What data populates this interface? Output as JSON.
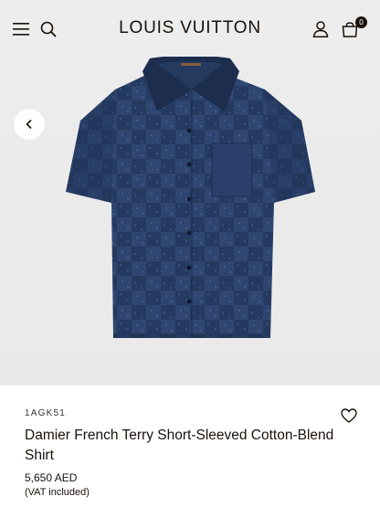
{
  "header": {
    "brand": "LOUIS VUITTON",
    "bag_count": "0",
    "icons": [
      "menu-icon",
      "search-icon",
      "account-icon",
      "shopping-bag-icon"
    ]
  },
  "gallery": {
    "back_icon": "chevron-left-icon",
    "image": "navy-damier-short-sleeve-shirt"
  },
  "product": {
    "sku": "1AGK51",
    "title": "Damier French Terry Short-Sleeved Cotton-Blend Shirt",
    "price": "5,650 AED",
    "vat_note": "(VAT included)",
    "wishlist_icon": "heart-icon"
  },
  "colors": {
    "header_bg": "#ededed",
    "gallery_bg": "#eaeaea",
    "text": "#19110b",
    "shirt": "#2c4166"
  }
}
